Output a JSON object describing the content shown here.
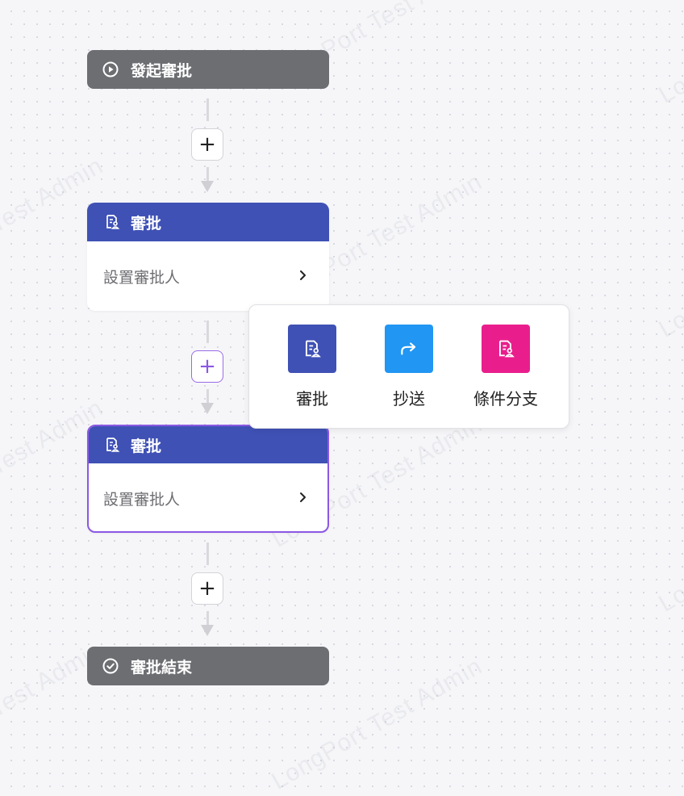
{
  "watermark": "LongPort Test Admin",
  "start_node": {
    "label": "發起審批",
    "icon": "play-circle-icon",
    "color": "#6c6e72"
  },
  "approval_nodes": [
    {
      "title": "審批",
      "placeholder": "設置審批人",
      "icon": "approval-doc-icon",
      "selected": false
    },
    {
      "title": "審批",
      "placeholder": "設置審批人",
      "icon": "approval-doc-icon",
      "selected": true
    }
  ],
  "add_button": {
    "symbol": "+"
  },
  "add_popover": {
    "options": [
      {
        "label": "審批",
        "icon": "approval-doc-icon",
        "color": "#3f51b5"
      },
      {
        "label": "抄送",
        "icon": "forward-arrow-icon",
        "color": "#2196f3"
      },
      {
        "label": "條件分支",
        "icon": "condition-branch-icon",
        "color": "#e91e8c"
      }
    ]
  },
  "end_node": {
    "label": "審批結束",
    "icon": "check-circle-icon",
    "color": "#6c6e72"
  },
  "colors": {
    "accent": "#8b58e3",
    "node_header": "#3f51b5"
  }
}
